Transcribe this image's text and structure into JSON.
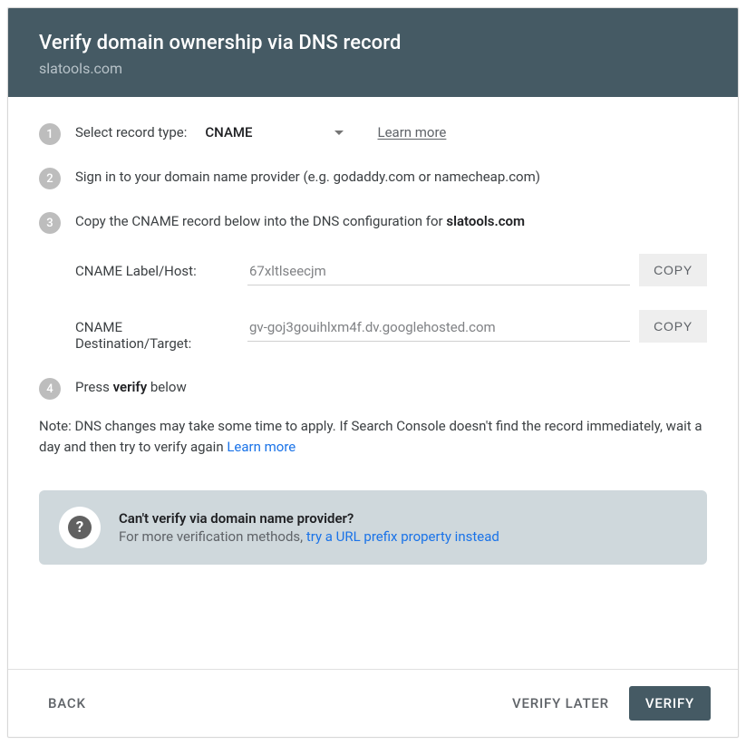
{
  "header": {
    "title": "Verify domain ownership via DNS record",
    "subtitle": "slatools.com"
  },
  "step1": {
    "label": "Select record type:",
    "select_value": "CNAME",
    "learn_more": "Learn more"
  },
  "step2": {
    "text": "Sign in to your domain name provider (e.g. godaddy.com or namecheap.com)"
  },
  "step3": {
    "prefix": "Copy the CNAME record below into the DNS configuration for ",
    "domain": "slatools.com",
    "field1_label": "CNAME Label/Host:",
    "field1_value": "67xltlseecjm",
    "field2_label": "CNAME Destination/Target:",
    "field2_value": "gv-goj3gouihlxm4f.dv.googlehosted.com",
    "copy_label": "COPY"
  },
  "step4": {
    "prefix": "Press ",
    "bold": "verify",
    "suffix": " below"
  },
  "note": {
    "text": "Note: DNS changes may take some time to apply. If Search Console doesn't find the record immediately, wait a day and then try to verify again ",
    "link": "Learn more"
  },
  "help": {
    "title": "Can't verify via domain name provider?",
    "sub_prefix": "For more verification methods, ",
    "sub_link": "try a URL prefix property instead"
  },
  "footer": {
    "back": "BACK",
    "verify_later": "VERIFY LATER",
    "verify": "VERIFY"
  }
}
